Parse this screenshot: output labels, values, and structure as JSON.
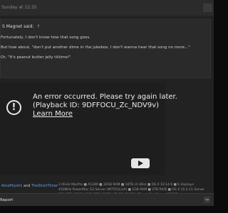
{
  "post": {
    "meta": "Sunday at 12:32",
    "quote": {
      "author": "S Magnet said:",
      "arrow_glyph": "↑",
      "lines": [
        "Fortunately, I don't know how that song goes.",
        "But how about, \"don't put another dime in the jukebox, I don't wanna hear that song no more...\"",
        "Or, \"It's peanut butter jelly tiiiiime!\""
      ]
    },
    "video": {
      "error_line1": "An error occurred. Please try again later.",
      "error_line2": "(Playback ID: 9DFFOCU_Zc_NDV9v)",
      "learn_more": "Learn More"
    },
    "signature": [
      "2.4GHz MacPro ■ A1289 ■ 32GB RAM ■ 10TB (4 HDs) ■ OS X 10.14.6 ■ 6 displays",
      "450MHz PowerMac G3 Server (M7551LL/A) ■ 1GB RAM ■ 2TB RAID ■ OS X 10.4.11 Server",
      "15\" MBP A1260 | 17\" MBP A1151 | 7\" PB A1013 | iPhone Pro Max ■ 512GB | ..."
    ],
    "likes": {
      "user1": "AmaPhysh1",
      "joiner": "and",
      "user2": "TheShortTimer"
    },
    "footer": {
      "report_label": "Report",
      "right_icon_glyph": "↪"
    }
  },
  "colors": {
    "link": "#6a9fe0",
    "panel": "#222222",
    "strip": "#2b2b2b"
  }
}
